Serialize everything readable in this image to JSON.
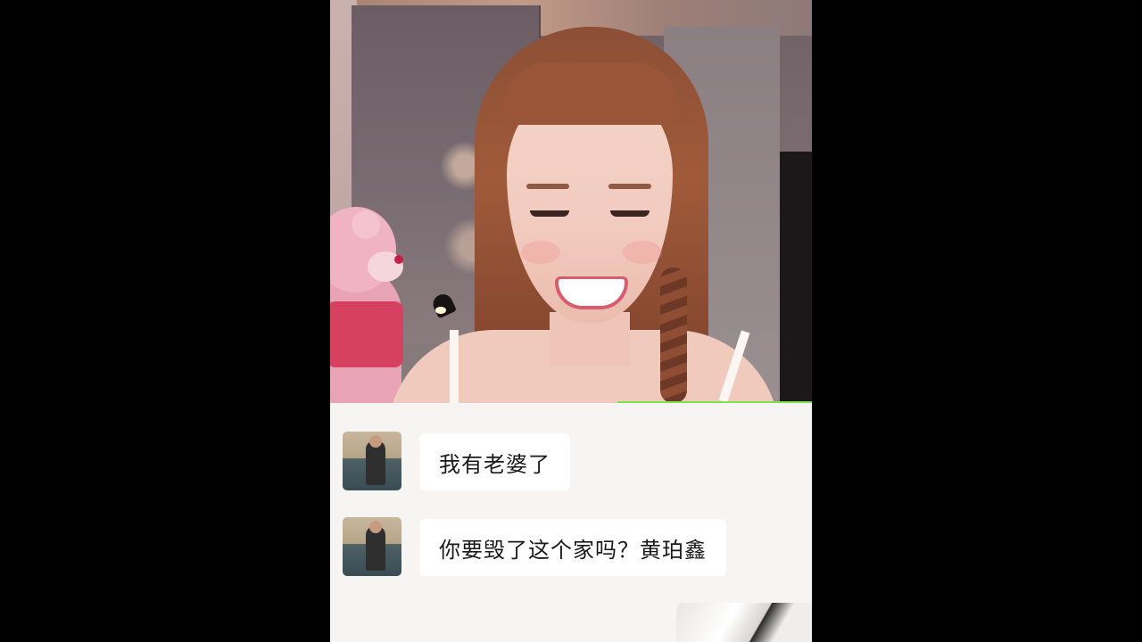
{
  "video": {
    "description_icon": "live-stream-video"
  },
  "progress": {
    "color": "#7ee34a"
  },
  "chat": {
    "messages": [
      {
        "text": "我有老婆了",
        "avatar": "user-avatar"
      },
      {
        "text": "你要毁了这个家吗？黄珀鑫",
        "avatar": "user-avatar"
      }
    ]
  }
}
